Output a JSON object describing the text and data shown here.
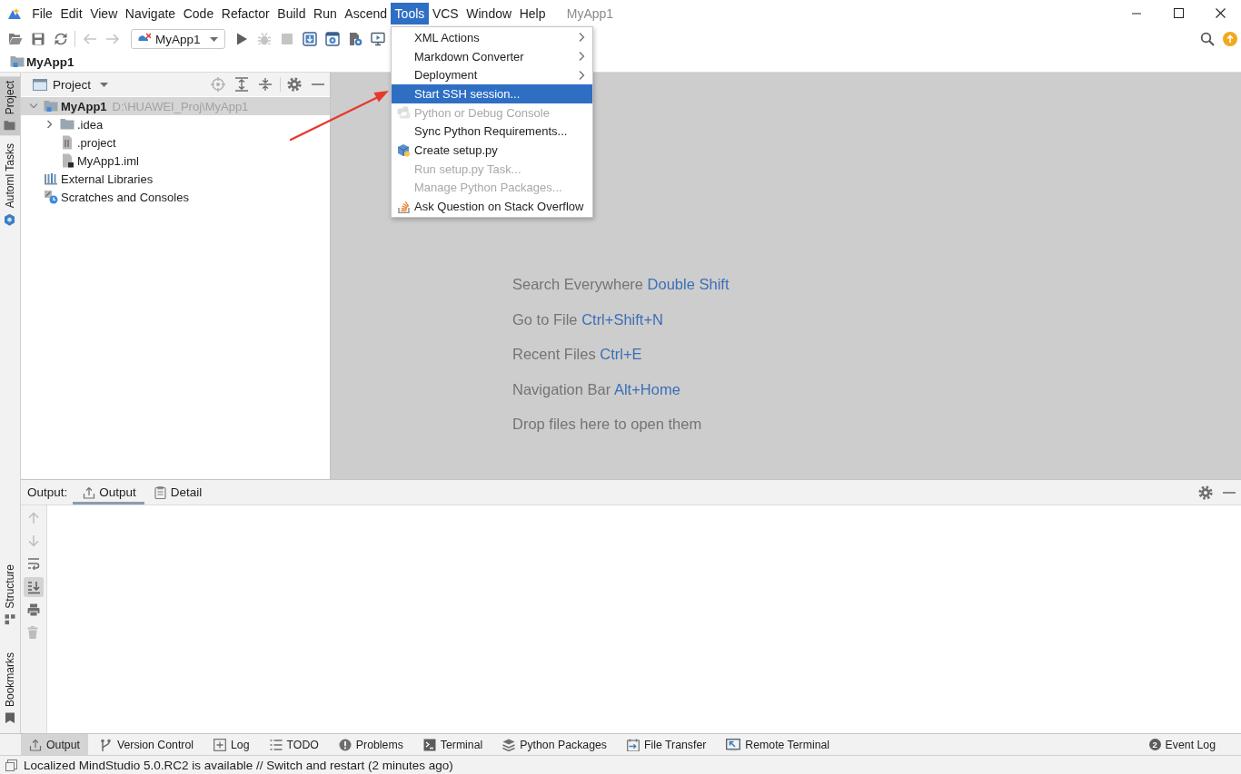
{
  "menu_bar": {
    "items": [
      {
        "label": "File",
        "selected": false
      },
      {
        "label": "Edit",
        "selected": false
      },
      {
        "label": "View",
        "selected": false
      },
      {
        "label": "Navigate",
        "selected": false
      },
      {
        "label": "Code",
        "selected": false
      },
      {
        "label": "Refactor",
        "selected": false
      },
      {
        "label": "Build",
        "selected": false
      },
      {
        "label": "Run",
        "selected": false
      },
      {
        "label": "Ascend",
        "selected": false
      },
      {
        "label": "Tools",
        "selected": true
      },
      {
        "label": "VCS",
        "selected": false
      },
      {
        "label": "Window",
        "selected": false
      },
      {
        "label": "Help",
        "selected": false
      }
    ],
    "title": "MyApp1"
  },
  "toolbar": {
    "file_buttons": [
      {
        "disabled": false
      },
      {
        "disabled": false
      },
      {
        "disabled": false
      }
    ],
    "history_buttons": [
      {
        "disabled": true
      },
      {
        "disabled": true
      }
    ],
    "run_config": "MyApp1",
    "run_buttons": [
      {
        "disabled": false
      },
      {
        "disabled": true
      },
      {
        "disabled": true
      },
      {
        "disabled": false
      },
      {
        "disabled": false
      },
      {
        "disabled": false
      },
      {
        "disabled": false
      }
    ]
  },
  "navigation_bar": {
    "crumbs": [
      "MyApp1"
    ]
  },
  "left_stripe": {
    "top_tabs": [
      {
        "label": "Project",
        "selected": true
      },
      {
        "label": "Automl Tasks",
        "selected": false
      }
    ],
    "bottom_tabs": [
      {
        "label": "Structure",
        "selected": false
      },
      {
        "label": "Bookmarks",
        "selected": false
      }
    ]
  },
  "project_panel": {
    "title": "Project",
    "tree": [
      {
        "label": "MyApp1",
        "path": "D:\\HUAWEI_Proj\\MyApp1",
        "kind": "module",
        "expanded": true,
        "selected": true,
        "children": [
          {
            "label": ".idea",
            "kind": "folder",
            "expanded": false,
            "selected": false
          },
          {
            "label": ".project",
            "kind": "file",
            "selected": false
          },
          {
            "label": "MyApp1.iml",
            "kind": "module_file",
            "selected": false
          }
        ]
      },
      {
        "label": "External Libraries",
        "kind": "libraries",
        "selected": false
      },
      {
        "label": "Scratches and Consoles",
        "kind": "scratches",
        "selected": false
      }
    ]
  },
  "editor": {
    "hints": [
      {
        "text": "Search Everywhere",
        "shortcut": "Double Shift"
      },
      {
        "text": "Go to File",
        "shortcut": "Ctrl+Shift+N"
      },
      {
        "text": "Recent Files",
        "shortcut": "Ctrl+E"
      },
      {
        "text": "Navigation Bar",
        "shortcut": "Alt+Home"
      },
      {
        "text": "Drop files here to open them"
      }
    ]
  },
  "tools_menu": {
    "items": [
      {
        "label": "XML Actions",
        "kind": "plain",
        "submenu": true,
        "disabled": false,
        "selected": false
      },
      {
        "label": "Markdown Converter",
        "kind": "plain",
        "submenu": true,
        "disabled": false,
        "selected": false
      },
      {
        "label": "Deployment",
        "kind": "plain",
        "submenu": true,
        "disabled": false,
        "selected": false
      },
      {
        "label": "Start SSH session...",
        "kind": "plain",
        "submenu": false,
        "disabled": false,
        "selected": true
      },
      {
        "label": "Python or Debug Console",
        "kind": "python",
        "submenu": false,
        "disabled": true,
        "selected": false
      },
      {
        "label": "Sync Python Requirements...",
        "kind": "plain",
        "submenu": false,
        "disabled": false,
        "selected": false
      },
      {
        "label": "Create setup.py",
        "kind": "package",
        "submenu": false,
        "disabled": false,
        "selected": false
      },
      {
        "label": "Run setup.py Task...",
        "kind": "plain",
        "submenu": false,
        "disabled": true,
        "selected": false
      },
      {
        "label": "Manage Python Packages...",
        "kind": "plain",
        "submenu": false,
        "disabled": true,
        "selected": false
      },
      {
        "label": "Ask Question on Stack Overflow",
        "kind": "stack",
        "submenu": false,
        "disabled": false,
        "selected": false
      }
    ]
  },
  "output_panel": {
    "label": "Output:",
    "tabs": [
      {
        "label": "Output",
        "selected": true
      },
      {
        "label": "Detail",
        "selected": false
      }
    ],
    "tools": [
      {
        "disabled": true,
        "on": false
      },
      {
        "disabled": true,
        "on": false
      },
      {
        "disabled": false,
        "on": false
      },
      {
        "disabled": false,
        "on": true
      },
      {
        "disabled": false,
        "on": false
      },
      {
        "disabled": true,
        "on": false
      }
    ]
  },
  "tool_window_bar": {
    "tabs": [
      {
        "label": "Output",
        "selected": true
      },
      {
        "label": "Version Control",
        "selected": false
      },
      {
        "label": "Log",
        "selected": false
      },
      {
        "label": "TODO",
        "selected": false
      },
      {
        "label": "Problems",
        "selected": false
      },
      {
        "label": "Terminal",
        "selected": false
      },
      {
        "label": "Python Packages",
        "selected": false
      },
      {
        "label": "File Transfer",
        "selected": false
      },
      {
        "label": "Remote Terminal",
        "selected": false
      }
    ],
    "event_log": {
      "label": "Event Log",
      "count": "2"
    }
  },
  "status_bar": {
    "message": "Localized MindStudio 5.0.RC2 is available // Switch and restart (2 minutes ago)"
  }
}
